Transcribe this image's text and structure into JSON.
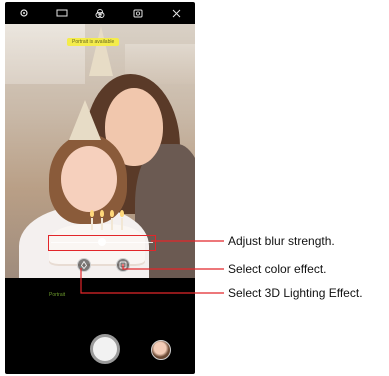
{
  "status_bar": {
    "icons": [
      "gear-icon",
      "flash-icon",
      "effects-icon",
      "switch-camera-icon",
      "close-icon"
    ]
  },
  "viewfinder": {
    "banner": "Portrait is available"
  },
  "blur_slider": {
    "level": 0.5
  },
  "mode_label": "Portrait",
  "callouts": {
    "blur": "Adjust blur strength.",
    "color": "Select color effect.",
    "lighting": "Select 3D Lighting Effect."
  },
  "colors": {
    "highlight": "#e2262a",
    "mode_text": "#6c9a2c",
    "banner_bg": "#f4ec4b"
  }
}
